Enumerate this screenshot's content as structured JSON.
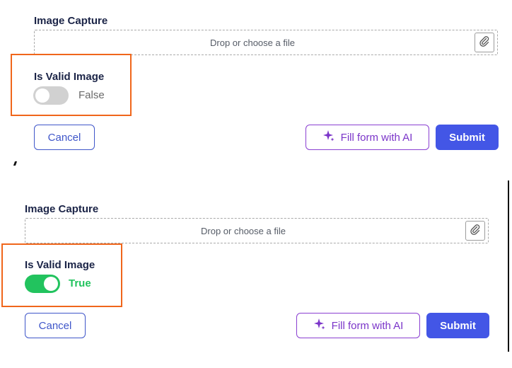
{
  "colors": {
    "heading": "#1b2447",
    "primary": "#4356e6",
    "ai_purple": "#7b35c9",
    "toggle_on": "#22c35e",
    "toggle_off": "#d1d1d1",
    "highlight": "#f0661b"
  },
  "icons": {
    "attach": "paperclip-icon",
    "ai": "sparkle-icon"
  },
  "panels": [
    {
      "image_capture_label": "Image Capture",
      "dropzone_text": "Drop or choose a file",
      "valid_label": "Is Valid Image",
      "toggle_state": "False",
      "toggle_on": false,
      "cancel_label": "Cancel",
      "ai_label": "Fill form with AI",
      "submit_label": "Submit"
    },
    {
      "image_capture_label": "Image Capture",
      "dropzone_text": "Drop or choose a file",
      "valid_label": "Is Valid Image",
      "toggle_state": "True",
      "toggle_on": true,
      "cancel_label": "Cancel",
      "ai_label": "Fill form with AI",
      "submit_label": "Submit"
    }
  ]
}
